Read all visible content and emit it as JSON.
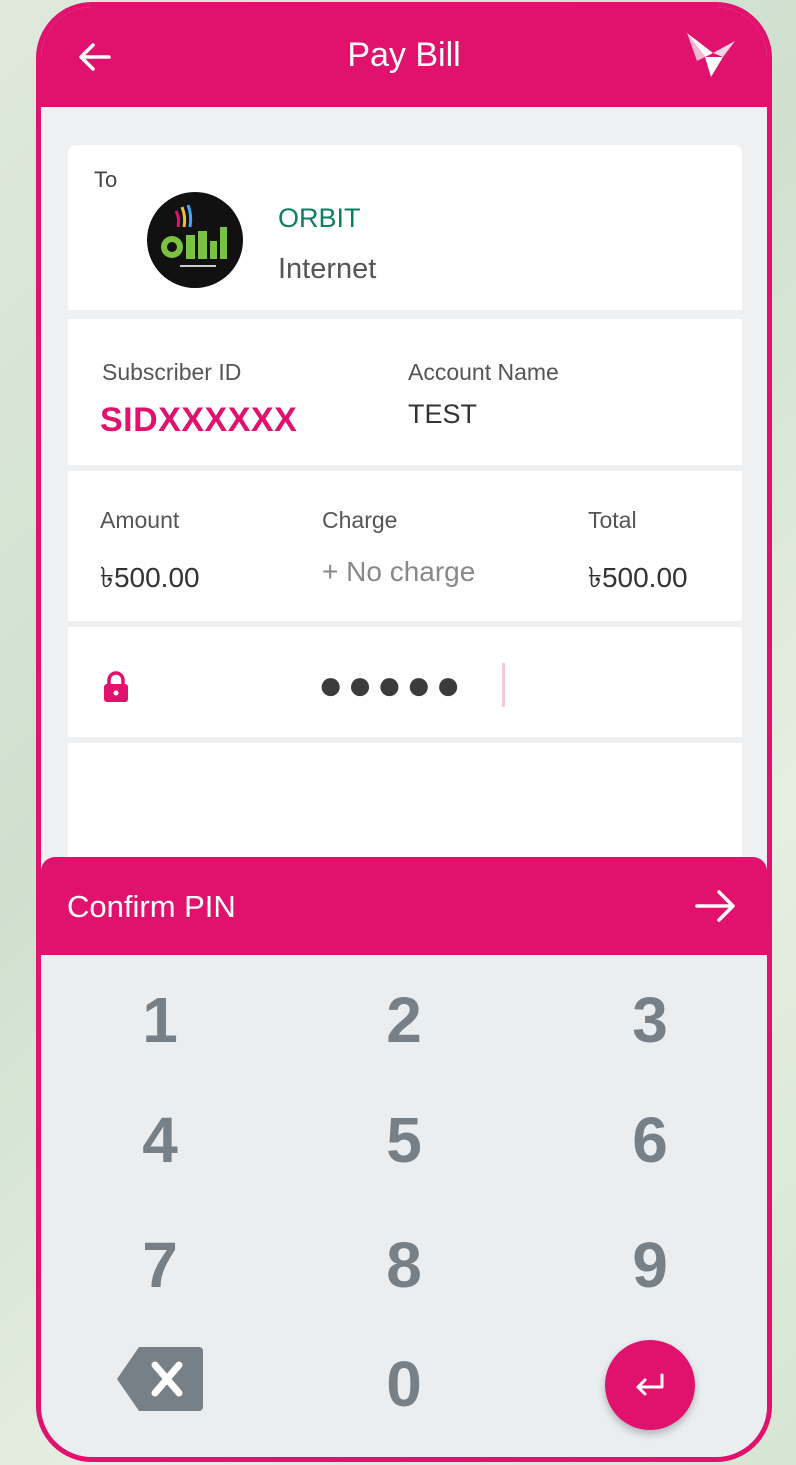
{
  "header": {
    "title": "Pay Bill",
    "back_icon": "arrow-left-icon",
    "logo_icon": "bird-logo-icon"
  },
  "recipient": {
    "to_label": "To",
    "logo_icon": "orbit-internet-logo",
    "merchant_name": "ORBIT",
    "merchant_category": "Internet"
  },
  "account": {
    "subscriber_label": "Subscriber ID",
    "subscriber_value": "SIDXXXXXX",
    "account_name_label": "Account Name",
    "account_name_value": "TEST"
  },
  "payment": {
    "amount_label": "Amount",
    "amount_value": "৳500.00",
    "charge_label": "Charge",
    "charge_value": "+ No charge",
    "total_label": "Total",
    "total_value": "৳500.00"
  },
  "pin": {
    "lock_icon": "lock-icon",
    "masked_value": "●●●●●"
  },
  "confirm": {
    "label": "Confirm PIN",
    "arrow_icon": "arrow-right-icon"
  },
  "keypad": {
    "keys": [
      "1",
      "2",
      "3",
      "4",
      "5",
      "6",
      "7",
      "8",
      "9",
      "0"
    ],
    "backspace_icon": "backspace-icon",
    "enter_icon": "enter-icon"
  },
  "colors": {
    "brand": "#e0126e",
    "merchant_name": "#0e7d64",
    "keypad_bg": "#ebeef1"
  }
}
